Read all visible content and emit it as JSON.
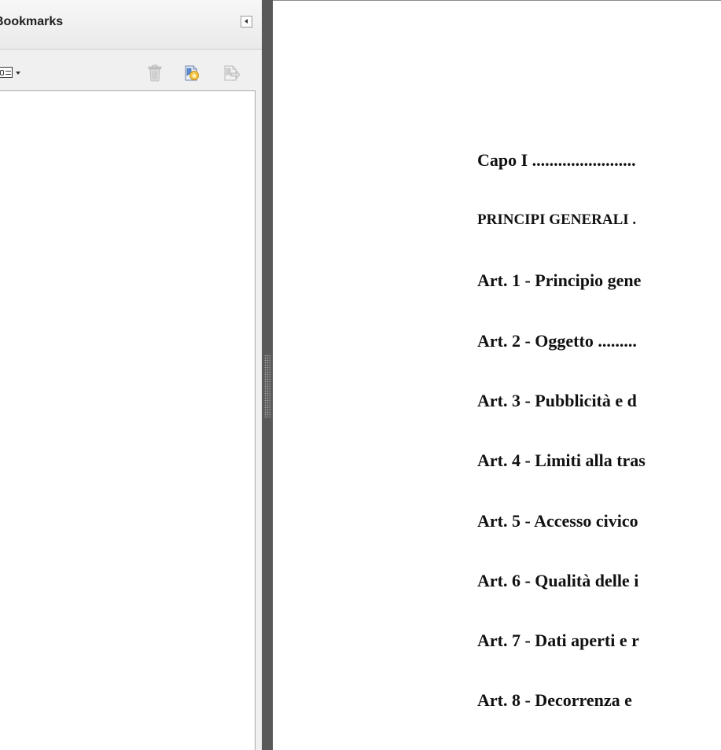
{
  "bookmarks_panel": {
    "title": "Bookmarks",
    "icons": {
      "collapse": "collapse-left-icon",
      "options": "options-menu-icon",
      "delete": "trash-icon",
      "new_bookmark": "new-bookmark-icon",
      "expand_bookmark": "goto-bookmark-icon"
    }
  },
  "document": {
    "toc": [
      "Capo I ........................",
      "PRINCIPI GENERALI .",
      "Art. 1 - Principio gene",
      "Art. 2 - Oggetto .........",
      "Art. 3 - Pubblicità e d",
      "Art. 4 - Limiti alla tras",
      "Art. 5 - Accesso civico",
      "Art. 6 - Qualità delle i",
      "Art. 7 - Dati aperti e r",
      "Art. 8 - Decorrenza e"
    ]
  },
  "colors": {
    "panel_bg": "#f0f0f0",
    "splitter": "#595959",
    "page_bg": "#ffffff",
    "text": "#111111"
  }
}
